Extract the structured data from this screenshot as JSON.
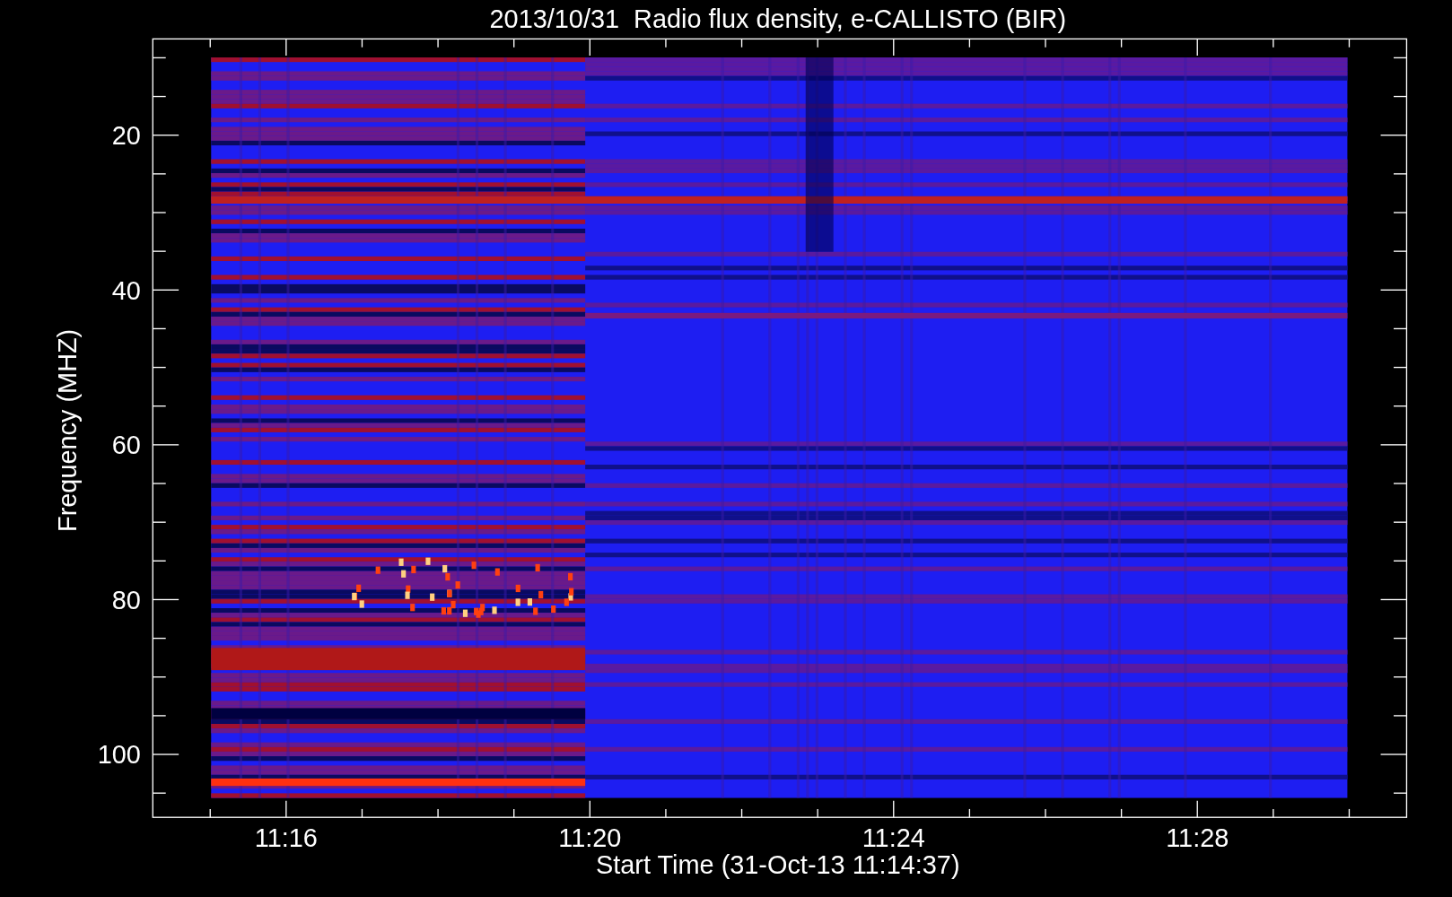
{
  "title": "2013/10/31  Radio flux density, e-CALLISTO (BIR)",
  "y_axis": {
    "label": "Frequency (MHZ)",
    "tick_labels": [
      "20",
      "40",
      "60",
      "80",
      "100"
    ]
  },
  "x_axis": {
    "label": "Start Time (31-Oct-13 11:14:37)",
    "tick_labels": [
      "11:16",
      "11:20",
      "11:24",
      "11:28"
    ]
  }
}
